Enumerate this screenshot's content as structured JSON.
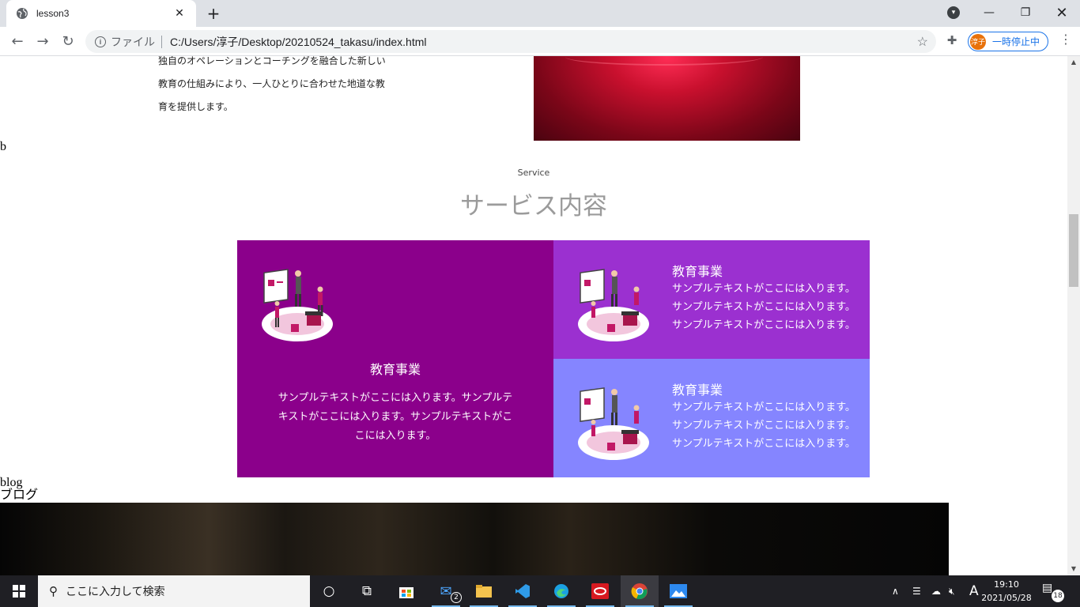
{
  "browser": {
    "tab_title": "lesson3",
    "new_tab_label": "+",
    "address_prefix": "ファイル",
    "url": "C:/Users/淳子/Desktop/20210524_takasu/index.html",
    "profile_initial": "淳子",
    "profile_status": "一時停止中"
  },
  "page": {
    "about_lines": [
      "独自のオペレーションとコーチングを融合した新しい",
      "教育の仕組みにより、一人ひとりに合わせた地道な教",
      "育を提供します。"
    ],
    "stray_text": "b",
    "service_en": "Service",
    "service_ja": "サービス内容",
    "cards": {
      "big": {
        "title": "教育事業",
        "body": "サンプルテキストがここには入ります。サンプルテキストがここには入ります。サンプルテキストがここには入ります。"
      },
      "small": [
        {
          "title": "教育事業",
          "lines": [
            "サンプルテキストがここには入ります。",
            "サンプルテキストがここには入ります。",
            "サンプルテキストがここには入ります。"
          ]
        },
        {
          "title": "教育事業",
          "lines": [
            "サンプルテキストがここには入ります。",
            "サンプルテキストがここには入ります。",
            "サンプルテキストがここには入ります。"
          ]
        }
      ]
    },
    "blog_en": "blog",
    "blog_ja": "ブログ"
  },
  "taskbar": {
    "search_placeholder": "ここに入力して検索",
    "mail_badge": "2",
    "ime": "A",
    "time": "19:10",
    "date": "2021/05/28",
    "notification_count": "18"
  },
  "colors": {
    "card_big": "#8b008b",
    "card_small_1": "#9b30d0",
    "card_small_2": "#8585ff",
    "service_title": "#9b9b9b"
  }
}
